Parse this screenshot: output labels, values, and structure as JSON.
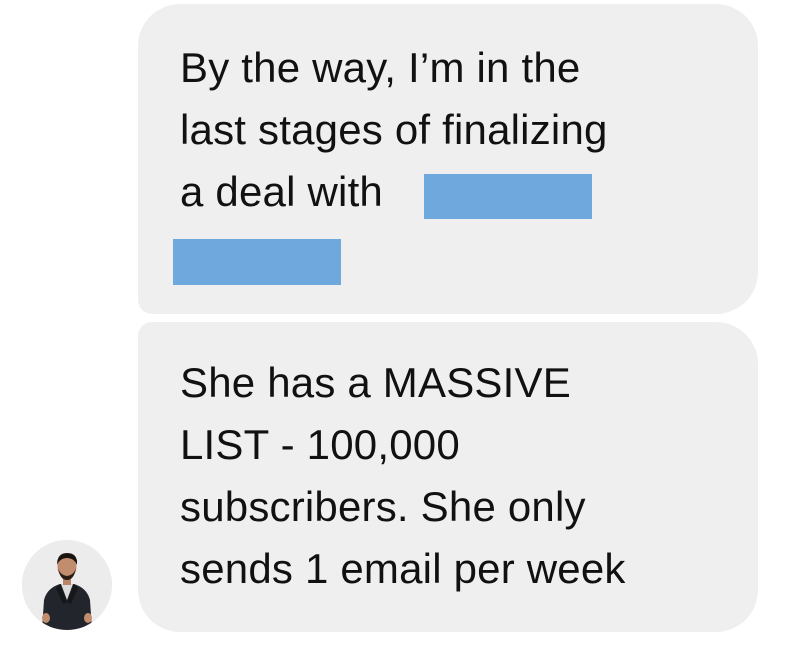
{
  "messages": [
    {
      "lines": [
        "By the way, I’m in the",
        "last stages of finalizing",
        "a deal with"
      ],
      "redactions": 2
    },
    {
      "lines": [
        "She has a MASSIVE",
        "LIST - 100,000",
        "subscribers. She only",
        "sends 1 email per week"
      ]
    }
  ],
  "colors": {
    "bubble_background": "#efeff0",
    "text": "#111111",
    "redaction": "#6fa8dc"
  },
  "sender": {
    "avatar_icon": "user-avatar-photo"
  }
}
